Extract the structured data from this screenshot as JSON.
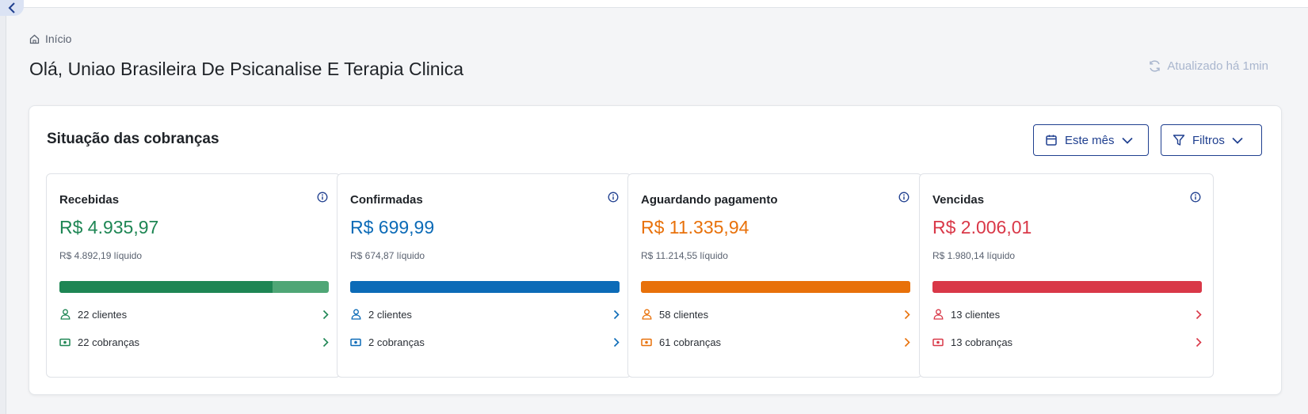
{
  "breadcrumb": {
    "label": "Início"
  },
  "header": {
    "title": "Olá, Uniao Brasileira De Psicanalise E Terapia Clinica",
    "updated": "Atualizado há 1min"
  },
  "panel": {
    "title": "Situação das cobranças",
    "period_button": "Este mês",
    "filters_button": "Filtros"
  },
  "cards": [
    {
      "title": "Recebidas",
      "amount": "R$ 4.935,97",
      "net": "R$ 4.892,19 líquido",
      "clients": "22 clientes",
      "charges": "22 cobranças",
      "color": "#1e8654",
      "light_color": "#4fa676",
      "progress_fraction": 0.79
    },
    {
      "title": "Confirmadas",
      "amount": "R$ 699,99",
      "net": "R$ 674,87 líquido",
      "clients": "2 clientes",
      "charges": "2 cobranças",
      "color": "#0c6bb7",
      "light_color": "#0c6bb7",
      "progress_fraction": 1.0
    },
    {
      "title": "Aguardando pagamento",
      "amount": "R$ 11.335,94",
      "net": "R$ 11.214,55 líquido",
      "clients": "58 clientes",
      "charges": "61 cobranças",
      "color": "#e8710a",
      "light_color": "#e8710a",
      "progress_fraction": 1.0
    },
    {
      "title": "Vencidas",
      "amount": "R$ 2.006,01",
      "net": "R$ 1.980,14 líquido",
      "clients": "13 clientes",
      "charges": "13 cobranças",
      "color": "#d93848",
      "light_color": "#d93848",
      "progress_fraction": 1.0
    }
  ],
  "colors": {
    "accent": "#1f3f8f",
    "updated_text": "#a9b6ce"
  }
}
